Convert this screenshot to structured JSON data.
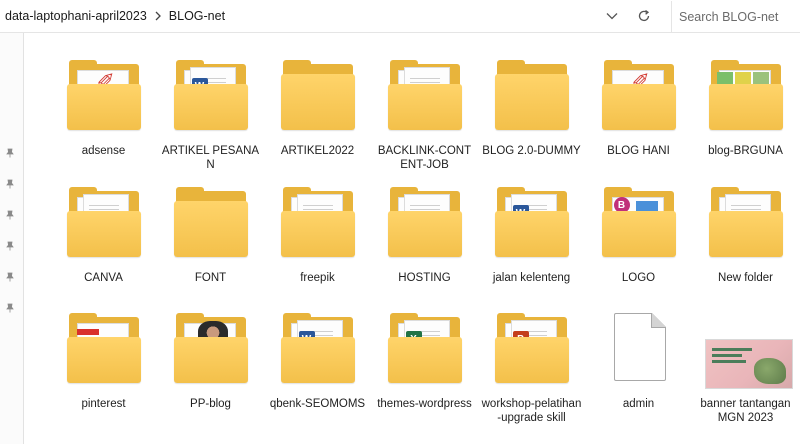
{
  "address_bar": {
    "breadcrumbs": [
      "data-laptophani-april2023",
      "BLOG-net"
    ],
    "separator_icon": "chevron-right-icon",
    "history_icon": "chevron-down-icon",
    "refresh_icon": "refresh-icon"
  },
  "search": {
    "placeholder": "Search BLOG-net",
    "value": ""
  },
  "nav_pane": {
    "pinned_count": 6,
    "pin_icon": "pin-icon"
  },
  "items": [
    {
      "label": "adsense",
      "kind": "folder",
      "content": "pdf",
      "accent": "#d23a32"
    },
    {
      "label": "ARTIKEL PESANAN",
      "kind": "folder",
      "content": "word",
      "accent": "#2b579a"
    },
    {
      "label": "ARTIKEL2022",
      "kind": "folder",
      "content": "empty"
    },
    {
      "label": "BACKLINK-CONTENT-JOB",
      "kind": "folder",
      "content": "document"
    },
    {
      "label": "BLOG 2.0-DUMMY",
      "kind": "folder",
      "content": "empty"
    },
    {
      "label": "BLOG HANI",
      "kind": "folder",
      "content": "pdf",
      "accent": "#d23a32"
    },
    {
      "label": "blog-BRGUNA",
      "kind": "folder",
      "content": "images"
    },
    {
      "label": "CANVA",
      "kind": "folder",
      "content": "document"
    },
    {
      "label": "FONT",
      "kind": "folder",
      "content": "empty"
    },
    {
      "label": "freepik",
      "kind": "folder",
      "content": "document"
    },
    {
      "label": "HOSTING",
      "kind": "folder",
      "content": "document"
    },
    {
      "label": "jalan kelenteng",
      "kind": "folder",
      "content": "word",
      "accent": "#2b579a"
    },
    {
      "label": "LOGO",
      "kind": "folder",
      "content": "logos",
      "accent": "#c0307a"
    },
    {
      "label": "New folder",
      "kind": "folder",
      "content": "document"
    },
    {
      "label": "pinterest",
      "kind": "folder",
      "content": "image-red",
      "accent": "#d9302c"
    },
    {
      "label": "PP-blog",
      "kind": "folder",
      "content": "photo"
    },
    {
      "label": "qbenk-SEOMOMS",
      "kind": "folder",
      "content": "word",
      "accent": "#2b579a"
    },
    {
      "label": "themes-wordpress",
      "kind": "folder",
      "content": "excel",
      "accent": "#217346"
    },
    {
      "label": "workshop-pelatihan-upgrade skill",
      "kind": "folder",
      "content": "powerpoint",
      "accent": "#c43e1c"
    },
    {
      "label": "admin",
      "kind": "file",
      "content": "blank"
    },
    {
      "label": "banner tantangan MGN 2023",
      "kind": "image",
      "content": "banner"
    }
  ]
}
